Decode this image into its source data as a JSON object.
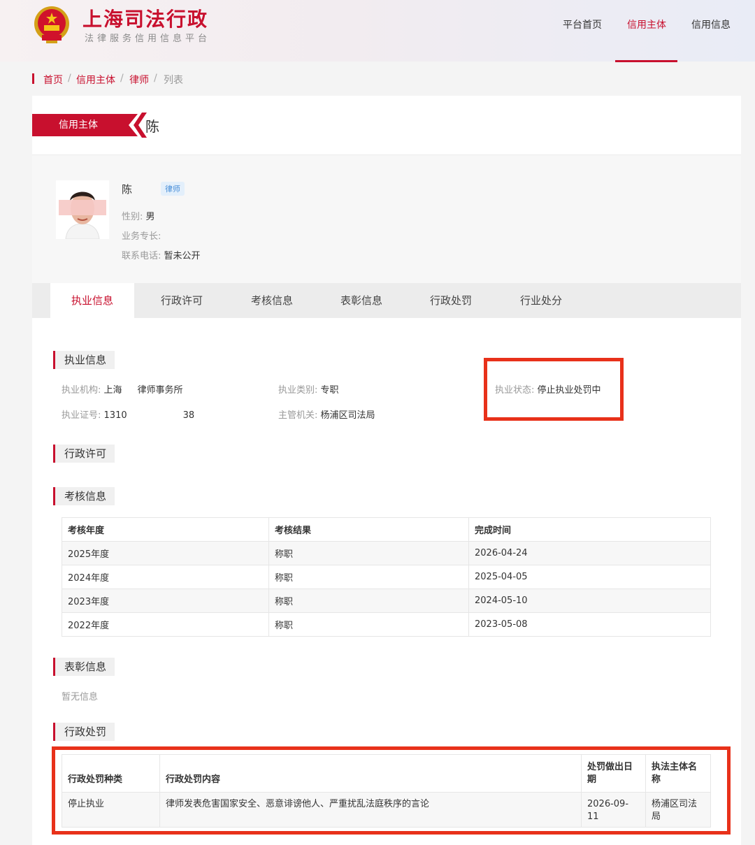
{
  "site": {
    "title": "上海司法行政",
    "subtitle": "法律服务信用信息平台",
    "emblem_icon": "national-emblem-icon"
  },
  "nav": {
    "items": [
      {
        "label": "平台首页",
        "active": false
      },
      {
        "label": "信用主体",
        "active": true
      },
      {
        "label": "信用信息",
        "active": false
      }
    ]
  },
  "breadcrumb": {
    "items": [
      "首页",
      "信用主体",
      "律师",
      "列表"
    ],
    "separator": "/"
  },
  "ribbon": {
    "label": "信用主体"
  },
  "subject": {
    "header_name": "陈",
    "name": "陈",
    "role_tag": "律师",
    "gender_label": "性别:",
    "gender": "男",
    "specialty_label": "业务专长:",
    "specialty": "",
    "phone_label": "联系电话:",
    "phone": "暂未公开"
  },
  "tabs": [
    {
      "label": "执业信息",
      "active": true
    },
    {
      "label": "行政许可",
      "active": false
    },
    {
      "label": "考核信息",
      "active": false
    },
    {
      "label": "表彰信息",
      "active": false
    },
    {
      "label": "行政处罚",
      "active": false
    },
    {
      "label": "行业处分",
      "active": false
    }
  ],
  "practice": {
    "title": "执业信息",
    "org_label": "执业机构:",
    "org": "上海",
    "org_suffix": "律师事务所",
    "type_label": "执业类别:",
    "type": "专职",
    "status_label": "执业状态:",
    "status": "停止执业处罚中",
    "cert_label": "执业证号:",
    "cert_prefix": "1310",
    "cert_suffix": "38",
    "authority_label": "主管机关:",
    "authority": "杨浦区司法局"
  },
  "license": {
    "title": "行政许可"
  },
  "exam": {
    "title": "考核信息",
    "headers": [
      "考核年度",
      "考核结果",
      "完成时间"
    ],
    "rows": [
      [
        "2025年度",
        "称职",
        "2026-04-24"
      ],
      [
        "2024年度",
        "称职",
        "2025-04-05"
      ],
      [
        "2023年度",
        "称职",
        "2024-05-10"
      ],
      [
        "2022年度",
        "称职",
        "2023-05-08"
      ]
    ]
  },
  "award": {
    "title": "表彰信息",
    "empty": "暂无信息"
  },
  "penalty": {
    "title": "行政处罚",
    "headers": [
      "行政处罚种类",
      "行政处罚内容",
      "处罚做出日期",
      "执法主体名称"
    ],
    "rows": [
      [
        "停止执业",
        "律师发表危害国家安全、恶意诽谤他人、严重扰乱法庭秩序的言论",
        "2026-09-11",
        "杨浦区司法局"
      ]
    ]
  },
  "colors": {
    "brand": "#c8102e",
    "highlight": "#e8311a",
    "tag": "#4a8fd8"
  }
}
